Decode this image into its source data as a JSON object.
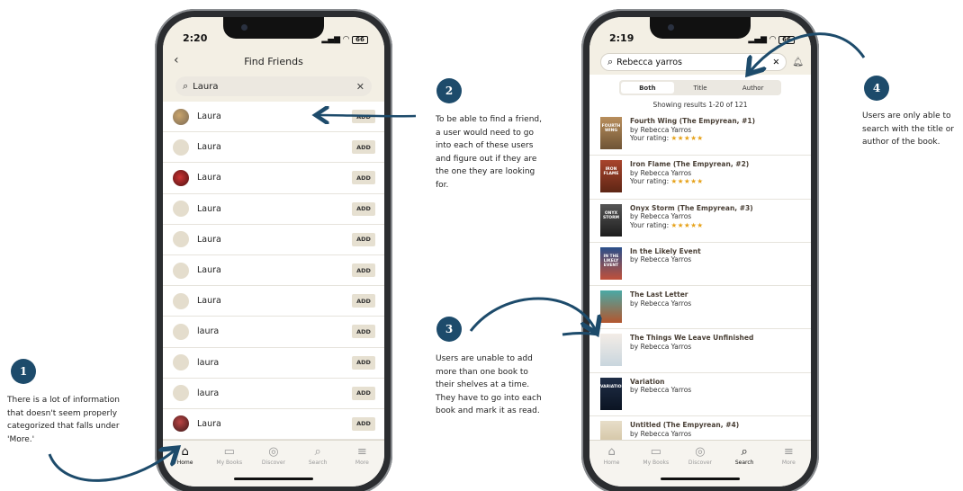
{
  "left_phone": {
    "status_time": "2:20",
    "battery": "66",
    "nav_title": "Find Friends",
    "search_value": "Laura",
    "add_label": "ADD",
    "friends": [
      {
        "name": "Laura"
      },
      {
        "name": "Laura"
      },
      {
        "name": "Laura"
      },
      {
        "name": "Laura"
      },
      {
        "name": "Laura"
      },
      {
        "name": "Laura"
      },
      {
        "name": "Laura"
      },
      {
        "name": "laura"
      },
      {
        "name": "laura"
      },
      {
        "name": "laura"
      },
      {
        "name": "Laura"
      }
    ],
    "tabs": [
      "Home",
      "My Books",
      "Discover",
      "Search",
      "More"
    ]
  },
  "right_phone": {
    "status_time": "2:19",
    "battery": "66",
    "search_value": "Rebecca yarros",
    "segments": [
      "Both",
      "Title",
      "Author"
    ],
    "results_count": "Showing results 1-20 of 121",
    "rating_label": "Your rating:",
    "stars": "★★★★★",
    "books": [
      {
        "title": "Fourth Wing (The Empyrean, #1)",
        "author": "by Rebecca Yarros",
        "rated": true,
        "cover_text": "FOURTH WING"
      },
      {
        "title": "Iron Flame (The Empyrean, #2)",
        "author": "by Rebecca Yarros",
        "rated": true,
        "cover_text": "IRON FLAME"
      },
      {
        "title": "Onyx Storm (The Empyrean, #3)",
        "author": "by Rebecca Yarros",
        "rated": true,
        "cover_text": "ONYX STORM"
      },
      {
        "title": "In the Likely Event",
        "author": "by Rebecca Yarros",
        "rated": false,
        "cover_text": "IN THE LIKELY EVENT"
      },
      {
        "title": "The Last Letter",
        "author": "by Rebecca Yarros",
        "rated": false,
        "cover_text": ""
      },
      {
        "title": "The Things We Leave Unfinished",
        "author": "by Rebecca Yarros",
        "rated": false,
        "cover_text": ""
      },
      {
        "title": "Variation",
        "author": "by Rebecca Yarros",
        "rated": false,
        "cover_text": "VARIATION"
      },
      {
        "title": "Untitled (The Empyrean, #4)",
        "author": "by Rebecca Yarros",
        "rated": false,
        "cover_text": ""
      }
    ],
    "tabs": [
      "Home",
      "My Books",
      "Discover",
      "Search",
      "More"
    ]
  },
  "annotations": [
    {
      "number": "1",
      "text": "There is a lot of information that doesn't seem properly categorized that falls under 'More.'"
    },
    {
      "number": "2",
      "text": "To be able to find a friend, a user would need to go into each of these users and figure out if they are the one they are looking for."
    },
    {
      "number": "3",
      "text": "Users are unable to add more than one book to their shelves at a time. They have to go into each book and mark it as read."
    },
    {
      "number": "4",
      "text": "Users are only able to search with the title or author of the book."
    }
  ],
  "colors": {
    "badge": "#1d4b6b",
    "arrow": "#1d4b6b",
    "header_bg": "#f3efe4",
    "stars": "#e6a21a"
  }
}
